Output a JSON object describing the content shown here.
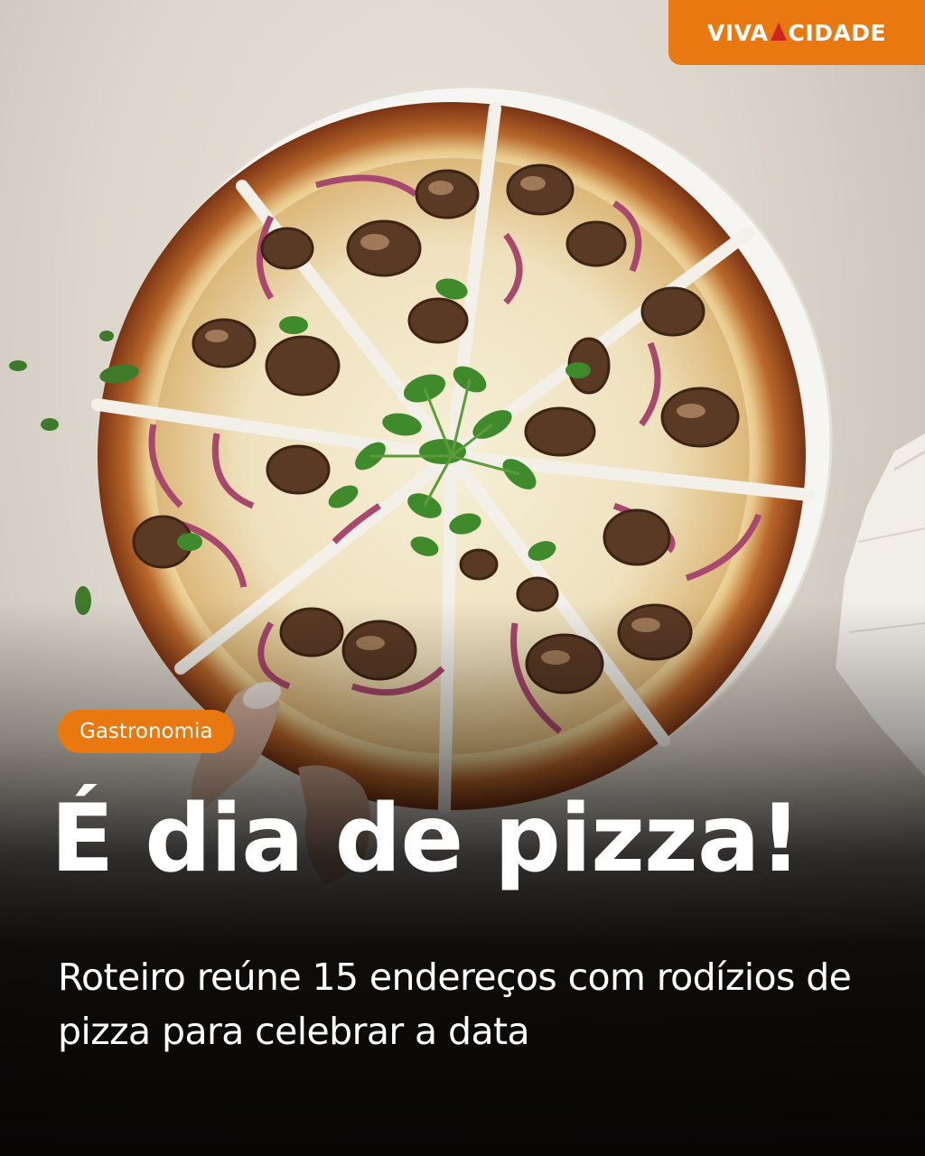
{
  "brand": {
    "logo_text_left": "VIVA",
    "logo_text_right": "CIDADE",
    "logo_color": "#e8780f",
    "logo_mark_color": "#c8281e"
  },
  "category": {
    "label": "Gastronomia"
  },
  "headline": "É dia de pizza!",
  "subtitle": "Roteiro reúne 15 endereços com rodízios de pizza para celebrar a data",
  "photo": {
    "subject": "mushroom-onion-pizza-icon"
  },
  "colors": {
    "accent": "#e8780f",
    "text": "#ffffff",
    "background_bottom": "#070605"
  }
}
